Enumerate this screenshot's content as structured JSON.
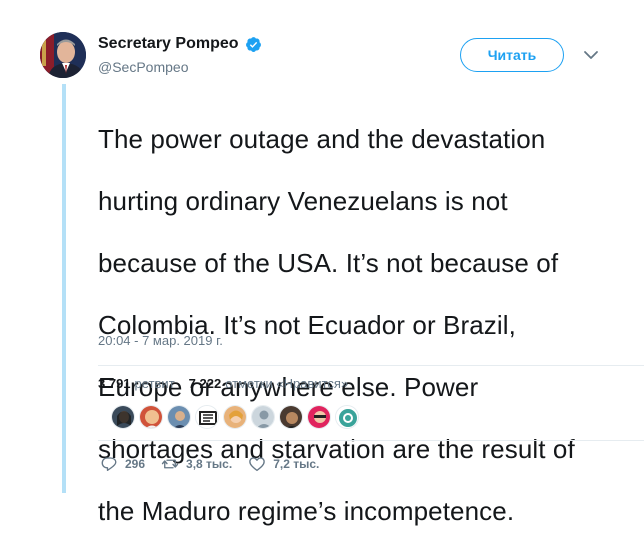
{
  "author": {
    "display_name": "Secretary Pompeo",
    "handle": "@SecPompeo",
    "verified": true
  },
  "follow_button": {
    "label": "Читать"
  },
  "tweet": {
    "text_lines": [
      "The power outage and the devastation",
      "hurting ordinary Venezuelans is not",
      "because of the USA. It’s not because of",
      "Colombia.  It’s not Ecuador or Brazil,",
      "Europe or anywhere else. Power",
      "shortages and starvation are the result of",
      "the Maduro regime’s incompetence."
    ],
    "timestamp": "20:04 - 7 мар. 2019 г."
  },
  "stats": {
    "retweets_count": "3 791",
    "retweets_label": "ретвит",
    "likes_count": "7 222",
    "likes_label": "отметки «Нравится»"
  },
  "actions": {
    "reply_count": "296",
    "retweet_count": "3,8 тыс.",
    "like_count": "7,2 тыс."
  },
  "colors": {
    "accent": "#1da1f2",
    "thread_line": "#b4e0f7",
    "muted": "#657786",
    "text": "#14171a",
    "divider": "#e6ecf0"
  }
}
